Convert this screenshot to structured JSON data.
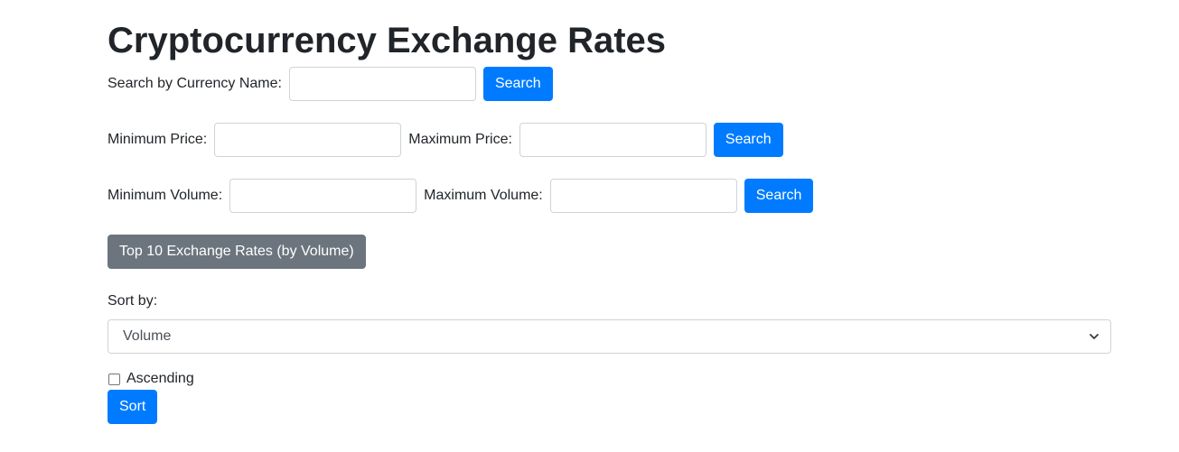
{
  "page": {
    "title": "Cryptocurrency Exchange Rates"
  },
  "name_search": {
    "label": "Search by Currency Name:",
    "value": "",
    "button_label": "Search"
  },
  "price_search": {
    "min_label": "Minimum Price:",
    "min_value": "",
    "max_label": "Maximum Price:",
    "max_value": "",
    "button_label": "Search"
  },
  "volume_search": {
    "min_label": "Minimum Volume:",
    "min_value": "",
    "max_label": "Maximum Volume:",
    "max_value": "",
    "button_label": "Search"
  },
  "top10": {
    "button_label": "Top 10 Exchange Rates (by Volume)"
  },
  "sort": {
    "label": "Sort by:",
    "selected": "Volume",
    "ascending_label": "Ascending",
    "ascending_checked": false,
    "button_label": "Sort"
  },
  "colors": {
    "primary": "#007bff",
    "secondary": "#6c757d",
    "text": "#212529",
    "border": "#ced4da"
  },
  "icons": {
    "select_arrow": "chevron-down-icon"
  }
}
